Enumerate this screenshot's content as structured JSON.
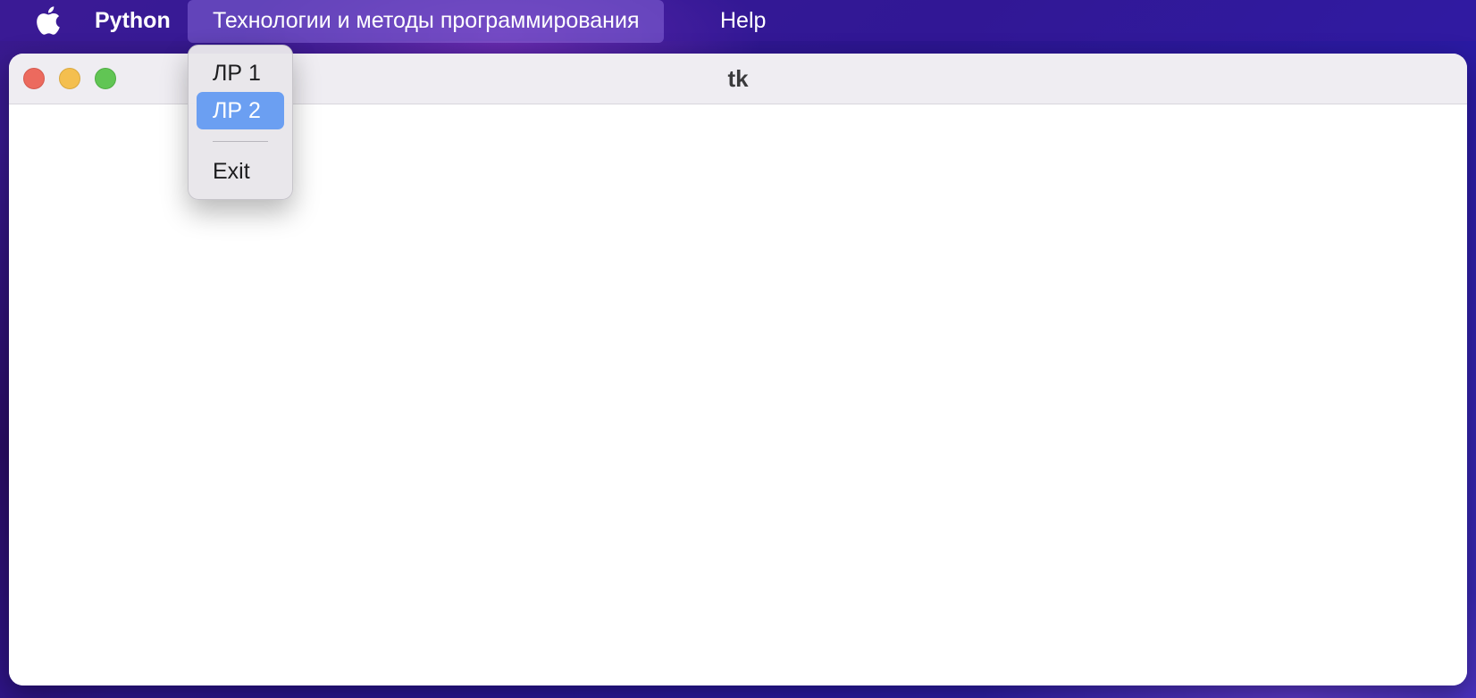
{
  "menubar": {
    "apple_icon": "apple-logo-icon",
    "app_name": "Python",
    "menus": [
      {
        "label": "Технологии и методы программирования"
      },
      {
        "label": "Help"
      }
    ]
  },
  "window": {
    "title": "tk",
    "controls": [
      "close-button",
      "minimize-button",
      "maximize-button"
    ]
  },
  "dropdown": {
    "items": [
      {
        "label": "ЛР 1"
      },
      {
        "label": "ЛР 2",
        "highlighted": true
      },
      {
        "label": "Exit"
      }
    ]
  },
  "colors": {
    "highlight": "#6b9ff2",
    "close": "#ec6a5e",
    "minimize": "#f4bf4f",
    "maximize": "#61c554"
  }
}
